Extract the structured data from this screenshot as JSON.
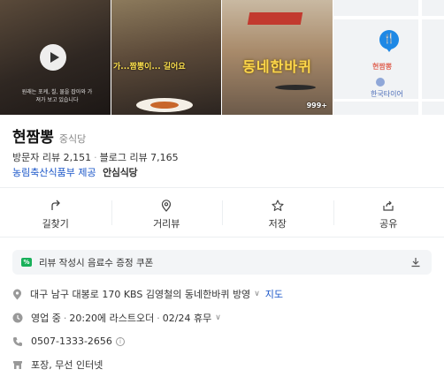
{
  "photos": [
    {
      "subtitle": "원래는 포케, 칠, 물을 잡아와 가져가 보고 있습니다",
      "icon": "play-icon"
    },
    {
      "caption": "가...짬뽕이... 길어요"
    },
    {
      "sign": "동네한바퀴",
      "count": "999+"
    },
    {
      "pin_label": "현짬뽕",
      "poi_label": "한국타이어"
    }
  ],
  "place": {
    "name": "현짬뽕",
    "category": "중식당",
    "visitor_reviews": "방문자 리뷰 2,151",
    "blog_reviews": "블로그 리뷰 7,165",
    "source_link": "농림축산식품부 제공",
    "source_brand": "안심식당"
  },
  "actions": [
    {
      "label": "길찾기",
      "icon": "directions-icon"
    },
    {
      "label": "거리뷰",
      "icon": "location-pin-icon"
    },
    {
      "label": "저장",
      "icon": "star-icon"
    },
    {
      "label": "공유",
      "icon": "share-icon"
    }
  ],
  "coupon": {
    "text": "리뷰 작성시 음료수 증정 쿠폰"
  },
  "info": {
    "address": "대구 남구 대봉로 170 KBS 김영철의 동네한바퀴 방영",
    "map_link": "지도",
    "hours_status": "영업 중",
    "hours_detail": "20:20에 라스트오더",
    "closed_day": "02/24 휴무",
    "phone": "0507-1333-2656",
    "amenities": "포장, 무선 인터넷"
  },
  "colors": {
    "link": "#1a56c8",
    "pin": "#1e88e5",
    "coupon_icon": "#19b05a"
  }
}
